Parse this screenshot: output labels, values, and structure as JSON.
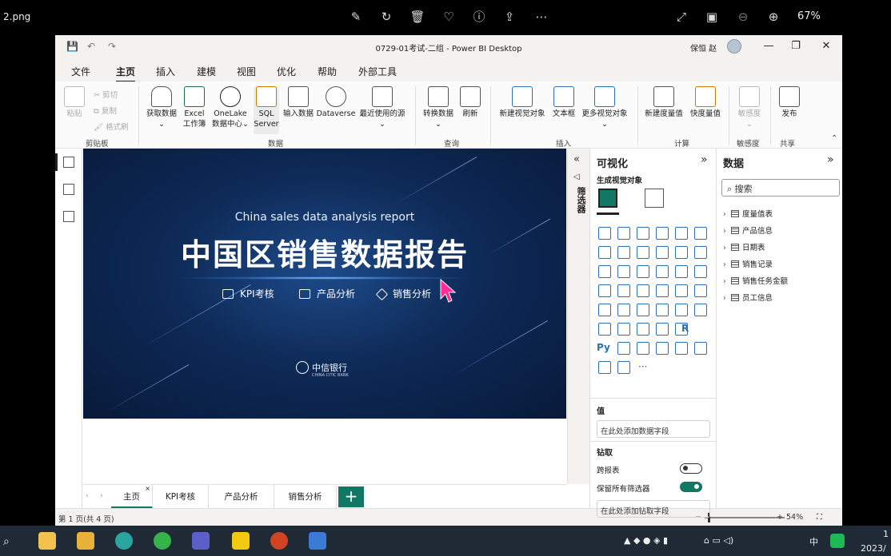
{
  "viewer": {
    "filename": "2.png",
    "zoom": "67%"
  },
  "window": {
    "title": "0729-01考试-二组 - Power BI Desktop",
    "user": "保恒 赵"
  },
  "menu": [
    "文件",
    "主页",
    "插入",
    "建模",
    "视图",
    "优化",
    "帮助",
    "外部工具"
  ],
  "ribbon": {
    "clipboard": {
      "paste": "粘贴",
      "cut": "剪切",
      "copy": "复制",
      "format_painter": "格式刷",
      "group": "剪贴板"
    },
    "data": {
      "get_data": "获取数据",
      "excel_line1": "Excel",
      "excel_line2": "工作簿",
      "onelake_line1": "OneLake",
      "onelake_line2": "数据中心",
      "sql_line1": "SQL",
      "sql_line2": "Server",
      "enter_data": "输入数据",
      "dataverse": "Dataverse",
      "recent": "最近使用的源",
      "group": "数据"
    },
    "query": {
      "transform": "转换数据",
      "refresh": "刷新",
      "group": "查询"
    },
    "insert": {
      "new_visual": "新建视觉对象",
      "textbox": "文本框",
      "more_visuals": "更多视觉对象",
      "group": "插入"
    },
    "calc": {
      "new_measure": "新建度量值",
      "quick_measure": "快度量值",
      "group": "计算"
    },
    "sensitivity": {
      "label": "敏感度",
      "group": "敏感度"
    },
    "share": {
      "publish": "发布",
      "group": "共享"
    }
  },
  "report": {
    "en_title": "China sales data analysis report",
    "cn_title": "中国区销售数据报告",
    "links": [
      "KPI考核",
      "产品分析",
      "销售分析"
    ],
    "bank": "中信银行",
    "bank_sub": "CHINA CITIC BANK"
  },
  "pages": {
    "tabs": [
      "主页",
      "KPI考核",
      "产品分析",
      "销售分析"
    ],
    "add": "+",
    "status": "第 1 页(共 4 页)",
    "zoom": "54%"
  },
  "filters": {
    "label": "筛选器"
  },
  "viz_pane": {
    "title": "可视化",
    "build": "生成视觉对象",
    "values_label": "值",
    "values_well": "在此处添加数据字段",
    "drill_label": "钻取",
    "cross_report": "跨报表",
    "keep_filters": "保留所有筛选器",
    "drill_well": "在此处添加钻取字段",
    "icon_r": "R",
    "icon_py": "Py",
    "more": "···"
  },
  "data_pane": {
    "title": "数据",
    "search_placeholder": "搜索",
    "tables": [
      "度量值表",
      "产品信息",
      "日期表",
      "销售记录",
      "销售任务金额",
      "员工信息"
    ]
  },
  "taskbar": {
    "ime": "中",
    "clock_line1": "1",
    "date": "2023/"
  },
  "colors": {
    "accent": "#117865",
    "report_bg": "#0e2a57",
    "cursor": "#ff2d95"
  }
}
